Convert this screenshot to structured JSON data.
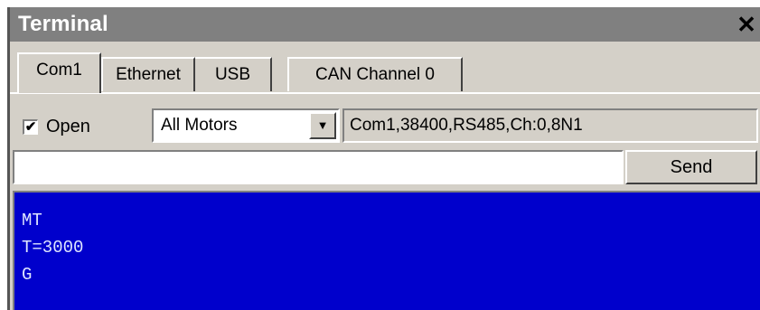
{
  "window": {
    "title": "Terminal",
    "close_glyph": "✕"
  },
  "tabs": [
    {
      "label": "Com1",
      "active": true
    },
    {
      "label": "Ethernet",
      "active": false
    },
    {
      "label": "USB",
      "active": false
    },
    {
      "label": "CAN Channel 0",
      "active": false
    }
  ],
  "connection": {
    "open_checked": true,
    "open_label": "Open",
    "check_glyph": "✔",
    "motor_select_value": "All Motors",
    "dropdown_glyph": "▼",
    "status": "Com1,38400,RS485,Ch:0,8N1"
  },
  "command": {
    "input_value": "",
    "send_label": "Send"
  },
  "output": {
    "lines": [
      "MT",
      "T=3000",
      "G"
    ]
  },
  "colors": {
    "titlebar": "#808080",
    "terminal_background": "#0000cc",
    "terminal_text": "#dfe6ff",
    "window_face": "#d4d0c8"
  }
}
